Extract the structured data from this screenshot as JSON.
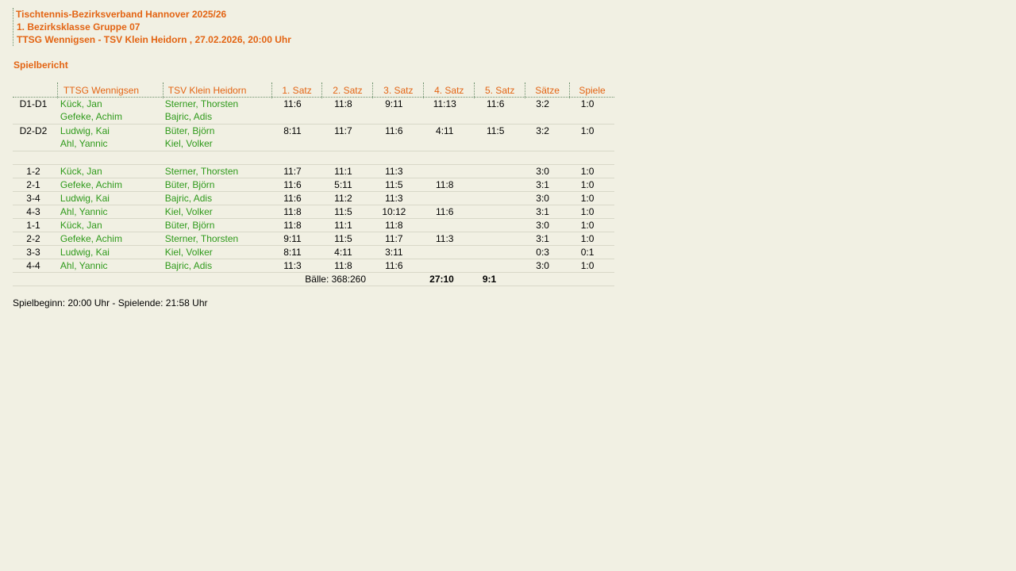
{
  "header": {
    "line1": "Tischtennis-Bezirksverband Hannover 2025/26",
    "line2": "1. Bezirksklasse Gruppe 07",
    "line3": "TTSG Wennigsen - TSV Klein Heidorn , 27.02.2026, 20:00 Uhr"
  },
  "report_title": "Spielbericht",
  "columns": {
    "id": "",
    "home": "TTSG Wennigsen",
    "away": "TSV Klein Heidorn",
    "set1": "1. Satz",
    "set2": "2. Satz",
    "set3": "3. Satz",
    "set4": "4. Satz",
    "set5": "5. Satz",
    "sets": "Sätze",
    "games": "Spiele"
  },
  "doubles": [
    {
      "id": "D1-D1",
      "home1": "Kück, Jan",
      "home2": "Gefeke, Achim",
      "away1": "Sterner, Thorsten",
      "away2": "Bajric, Adis",
      "s1": "11:6",
      "s2": "11:8",
      "s3": "9:11",
      "s4": "11:13",
      "s5": "11:6",
      "sets": "3:2",
      "games": "1:0"
    },
    {
      "id": "D2-D2",
      "home1": "Ludwig, Kai",
      "home2": "Ahl, Yannic",
      "away1": "Büter, Björn",
      "away2": "Kiel, Volker",
      "s1": "8:11",
      "s2": "11:7",
      "s3": "11:6",
      "s4": "4:11",
      "s5": "11:5",
      "sets": "3:2",
      "games": "1:0"
    }
  ],
  "singles": [
    {
      "id": "1-2",
      "home": "Kück, Jan",
      "away": "Sterner, Thorsten",
      "s1": "11:7",
      "s2": "11:1",
      "s3": "11:3",
      "s4": "",
      "s5": "",
      "sets": "3:0",
      "games": "1:0"
    },
    {
      "id": "2-1",
      "home": "Gefeke, Achim",
      "away": "Büter, Björn",
      "s1": "11:6",
      "s2": "5:11",
      "s3": "11:5",
      "s4": "11:8",
      "s5": "",
      "sets": "3:1",
      "games": "1:0"
    },
    {
      "id": "3-4",
      "home": "Ludwig, Kai",
      "away": "Bajric, Adis",
      "s1": "11:6",
      "s2": "11:2",
      "s3": "11:3",
      "s4": "",
      "s5": "",
      "sets": "3:0",
      "games": "1:0"
    },
    {
      "id": "4-3",
      "home": "Ahl, Yannic",
      "away": "Kiel, Volker",
      "s1": "11:8",
      "s2": "11:5",
      "s3": "10:12",
      "s4": "11:6",
      "s5": "",
      "sets": "3:1",
      "games": "1:0"
    },
    {
      "id": "1-1",
      "home": "Kück, Jan",
      "away": "Büter, Björn",
      "s1": "11:8",
      "s2": "11:1",
      "s3": "11:8",
      "s4": "",
      "s5": "",
      "sets": "3:0",
      "games": "1:0"
    },
    {
      "id": "2-2",
      "home": "Gefeke, Achim",
      "away": "Sterner, Thorsten",
      "s1": "9:11",
      "s2": "11:5",
      "s3": "11:7",
      "s4": "11:3",
      "s5": "",
      "sets": "3:1",
      "games": "1:0"
    },
    {
      "id": "3-3",
      "home": "Ludwig, Kai",
      "away": "Kiel, Volker",
      "s1": "8:11",
      "s2": "4:11",
      "s3": "3:11",
      "s4": "",
      "s5": "",
      "sets": "0:3",
      "games": "0:1"
    },
    {
      "id": "4-4",
      "home": "Ahl, Yannic",
      "away": "Bajric, Adis",
      "s1": "11:3",
      "s2": "11:8",
      "s3": "11:6",
      "s4": "",
      "s5": "",
      "sets": "3:0",
      "games": "1:0"
    }
  ],
  "totals": {
    "balls": "Bälle: 368:260",
    "sets": "27:10",
    "games": "9:1"
  },
  "footer": "Spielbeginn: 20:00 Uhr - Spielende: 21:58 Uhr",
  "colors": {
    "background": "#f1f0e3",
    "accent": "#e36413",
    "player": "#2f9a1b"
  }
}
